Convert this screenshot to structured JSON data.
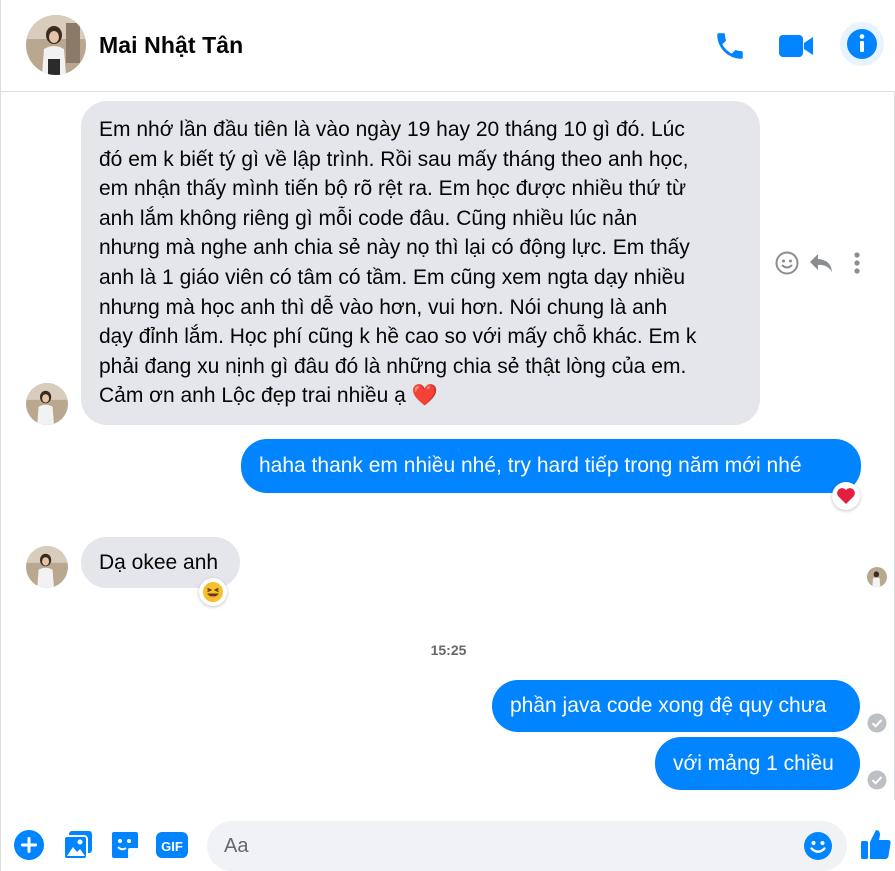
{
  "contact": {
    "name": "Mai Nhật Tân"
  },
  "header": {
    "icons": [
      "phone-icon",
      "video-camera-icon",
      "info-icon"
    ]
  },
  "messages": [
    {
      "direction": "in",
      "text": "Em nhớ lần đầu tiên là vào ngày 19 hay 20 tháng 10 gì đó. Lúc\nđó em k biết tý gì về lập trình. Rồi sau mấy tháng theo anh học,\nem nhận thấy mình tiến bộ rõ rệt ra. Em học được nhiều thứ từ\nanh lắm không riêng gì mỗi code đâu. Cũng nhiều lúc nản\nnhưng mà nghe anh chia sẻ này nọ thì lại có động lực. Em thấy\nanh là 1 giáo viên có tâm có tầm. Em cũng xem ngta dạy nhiều\nnhưng mà học anh thì dễ vào hơn, vui hơn. Nói chung là anh\ndạy đỉnh lắm. Học phí cũng k hề cao so với mấy chỗ khác. Em k\nphải đang xu nịnh gì đâu đó là những chia sẻ thật lòng của em.\nCảm ơn anh Lộc đẹp trai nhiều ạ ❤️"
    },
    {
      "direction": "out",
      "text": "haha thank em nhiều nhé, try hard tiếp trong năm mới nhé",
      "reaction": "heart"
    },
    {
      "direction": "in",
      "text": "Dạ okee anh",
      "reaction": "laughing"
    },
    {
      "direction": "out",
      "text": "phần java code xong đệ quy chưa",
      "status": "sent"
    },
    {
      "direction": "out",
      "text": "với mảng 1 chiều",
      "status": "sent"
    }
  ],
  "timestamp": "15:25",
  "composer": {
    "placeholder": "Aa",
    "value": ""
  },
  "colors": {
    "accent": "#0084ff",
    "incoming_bubble": "#e4e6eb",
    "reaction_heart": "#e41e3f"
  }
}
